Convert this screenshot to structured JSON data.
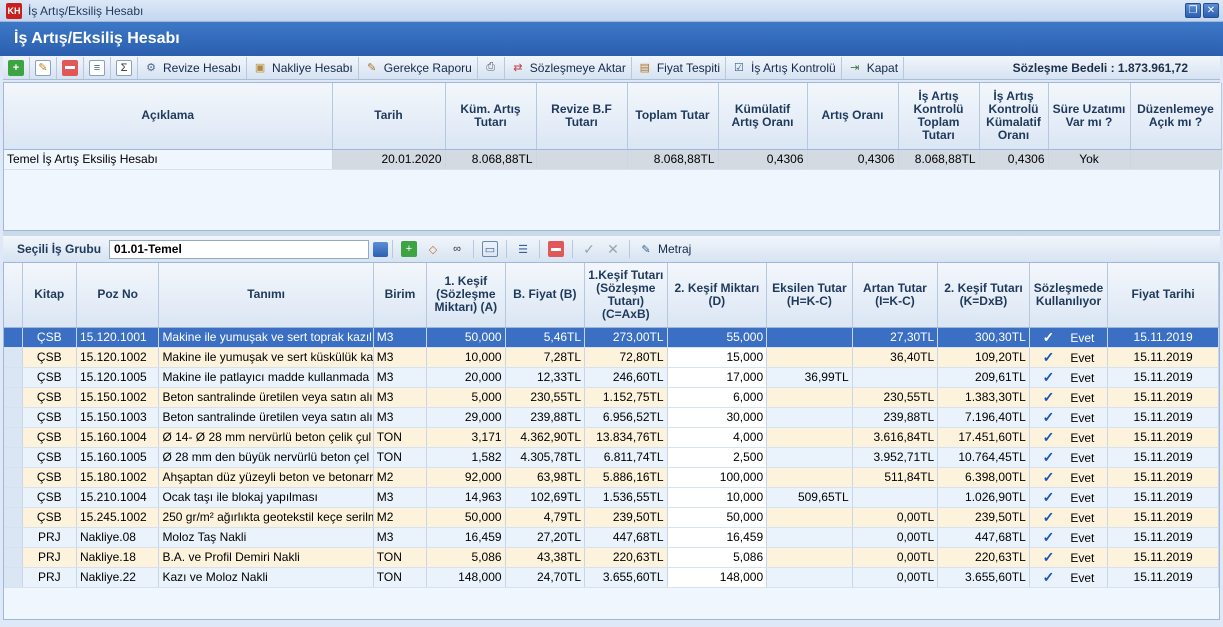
{
  "window": {
    "icon_text": "KH",
    "title": "İş Artış/Eksiliş Hesabı",
    "min_icon": "restore-icon",
    "close_icon": "close-icon"
  },
  "header": {
    "title": "İş Artış/Eksiliş Hesabı"
  },
  "toolbar": {
    "items": [
      {
        "icon": "add-icon",
        "label": ""
      },
      {
        "icon": "edit-icon",
        "label": ""
      },
      {
        "icon": "delete-icon",
        "label": ""
      },
      {
        "icon": "document-icon",
        "label": ""
      },
      {
        "icon": "sum-icon",
        "label": ""
      },
      {
        "icon": "revize-icon",
        "label": "Revize Hesabı"
      },
      {
        "icon": "box-icon",
        "label": "Nakliye Hesabı"
      },
      {
        "icon": "pencil-doc-icon",
        "label": "Gerekçe Raporu"
      },
      {
        "icon": "printer-icon",
        "label": ""
      },
      {
        "icon": "transfer-icon",
        "label": "Sözleşmeye Aktar"
      },
      {
        "icon": "price-icon",
        "label": "Fiyat Tespiti"
      },
      {
        "icon": "check-doc-icon",
        "label": "İş Artış Kontrolü"
      },
      {
        "icon": "exit-icon",
        "label": "Kapat"
      }
    ],
    "contract_value": "Sözleşme Bedeli : 1.873.961,72"
  },
  "summary": {
    "headers": [
      "Açıklama",
      "Tarih",
      "Küm. Artış Tutarı",
      "Revize B.F Tutarı",
      "Toplam Tutar",
      "Kümülatif Artış Oranı",
      "Artış Oranı",
      "İş Artış Kontrolü Toplam Tutarı",
      "İş Artış Kontrolü Kümalatif Oranı",
      "Süre Uzatımı Var mı ?",
      "Düzenlemeye Açık mı ?"
    ],
    "rows": [
      [
        "Temel İş Artış Eksiliş Hesabı",
        "20.01.2020",
        "8.068,88TL",
        "",
        "8.068,88TL",
        "0,4306",
        "0,4306",
        "8.068,88TL",
        "0,4306",
        "Yok",
        ""
      ]
    ]
  },
  "work_group": {
    "label": "Seçili İş Grubu",
    "value": "01.01-Temel",
    "metraj_label": "Metraj"
  },
  "items": {
    "headers": [
      "Kitap",
      "Poz No",
      "Tanımı",
      "Birim",
      "1. Keşif (Sözleşme Miktarı) (A)",
      "B. Fiyat (B)",
      "1.Keşif Tutarı (Sözleşme Tutarı) (C=AxB)",
      "2. Keşif Miktarı (D)",
      "Eksilen Tutar (H=K-C)",
      "Artan Tutar (I=K-C)",
      "2. Keşif Tutarı (K=DxB)",
      "Sözleşmede Kullanılıyor",
      "Fiyat Tarihi"
    ],
    "rows": [
      [
        "ÇSB",
        "15.120.1001",
        "Makine ile yumuşak ve sert toprak kazılı",
        "M3",
        "50,000",
        "5,46TL",
        "273,00TL",
        "55,000",
        "",
        "27,30TL",
        "300,30TL",
        "Evet",
        "15.11.2019"
      ],
      [
        "ÇSB",
        "15.120.1002",
        "Makine ile yumuşak ve sert küskülük ka",
        "M3",
        "10,000",
        "7,28TL",
        "72,80TL",
        "15,000",
        "",
        "36,40TL",
        "109,20TL",
        "Evet",
        "15.11.2019"
      ],
      [
        "ÇSB",
        "15.120.1005",
        "Makine ile patlayıcı madde kullanmada",
        "M3",
        "20,000",
        "12,33TL",
        "246,60TL",
        "17,000",
        "36,99TL",
        "",
        "209,61TL",
        "Evet",
        "15.11.2019"
      ],
      [
        "ÇSB",
        "15.150.1002",
        "Beton santralinde üretilen veya satın alı",
        "M3",
        "5,000",
        "230,55TL",
        "1.152,75TL",
        "6,000",
        "",
        "230,55TL",
        "1.383,30TL",
        "Evet",
        "15.11.2019"
      ],
      [
        "ÇSB",
        "15.150.1003",
        "Beton santralinde üretilen veya satın alı",
        "M3",
        "29,000",
        "239,88TL",
        "6.956,52TL",
        "30,000",
        "",
        "239,88TL",
        "7.196,40TL",
        "Evet",
        "15.11.2019"
      ],
      [
        "ÇSB",
        "15.160.1004",
        "Ø 14- Ø 28 mm nervürlü beton çelik çul",
        "TON",
        "3,171",
        "4.362,90TL",
        "13.834,76TL",
        "4,000",
        "",
        "3.616,84TL",
        "17.451,60TL",
        "Evet",
        "15.11.2019"
      ],
      [
        "ÇSB",
        "15.160.1005",
        "Ø 28 mm den büyük nervürlü beton çel",
        "TON",
        "1,582",
        "4.305,78TL",
        "6.811,74TL",
        "2,500",
        "",
        "3.952,71TL",
        "10.764,45TL",
        "Evet",
        "15.11.2019"
      ],
      [
        "ÇSB",
        "15.180.1002",
        "Ahşaptan düz yüzeyli beton ve betonarr",
        "M2",
        "92,000",
        "63,98TL",
        "5.886,16TL",
        "100,000",
        "",
        "511,84TL",
        "6.398,00TL",
        "Evet",
        "15.11.2019"
      ],
      [
        "ÇSB",
        "15.210.1004",
        "Ocak taşı ile blokaj yapılması",
        "M3",
        "14,963",
        "102,69TL",
        "1.536,55TL",
        "10,000",
        "509,65TL",
        "",
        "1.026,90TL",
        "Evet",
        "15.11.2019"
      ],
      [
        "ÇSB",
        "15.245.1002",
        "250 gr/m² ağırlıkta geotekstil keçe serilm",
        "M2",
        "50,000",
        "4,79TL",
        "239,50TL",
        "50,000",
        "",
        "0,00TL",
        "239,50TL",
        "Evet",
        "15.11.2019"
      ],
      [
        "PRJ",
        "Nakliye.08",
        "Moloz Taş Nakli",
        "M3",
        "16,459",
        "27,20TL",
        "447,68TL",
        "16,459",
        "",
        "0,00TL",
        "447,68TL",
        "Evet",
        "15.11.2019"
      ],
      [
        "PRJ",
        "Nakliye.18",
        "B.A. ve Profil Demiri Nakli",
        "TON",
        "5,086",
        "43,38TL",
        "220,63TL",
        "5,086",
        "",
        "0,00TL",
        "220,63TL",
        "Evet",
        "15.11.2019"
      ],
      [
        "PRJ",
        "Nakliye.22",
        "Kazı ve Moloz Nakli",
        "TON",
        "148,000",
        "24,70TL",
        "3.655,60TL",
        "148,000",
        "",
        "0,00TL",
        "3.655,60TL",
        "Evet",
        "15.11.2019"
      ]
    ],
    "selected_row": 0
  },
  "colors": {
    "header_band": "#2f67b6",
    "selected_row": "#3a6fc4",
    "row_alt_a": "#eaf3fb",
    "row_alt_b": "#fdf3dc"
  }
}
